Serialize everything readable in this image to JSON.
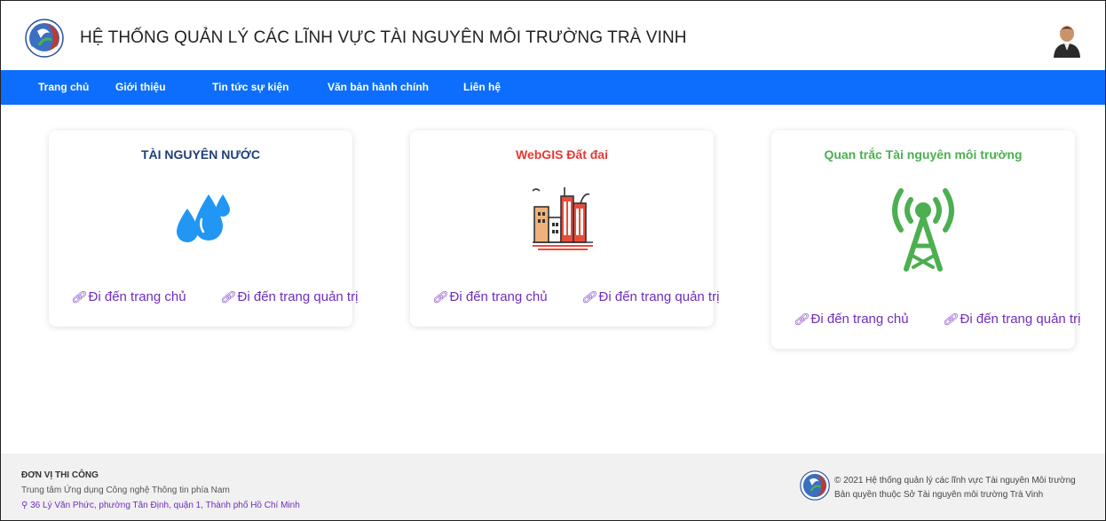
{
  "header": {
    "title": "HỆ THỐNG QUẢN LÝ CÁC LĨNH VỰC TÀI NGUYÊN MÔI TRƯỜNG TRÀ VINH"
  },
  "nav": {
    "items": [
      "Trang chủ",
      "Giới thiệu",
      "Tin tức sự kiện",
      "Văn bản hành chính",
      "Liên hệ"
    ]
  },
  "cards": [
    {
      "title": "TÀI NGUYÊN NƯỚC",
      "title_color": "#1f3f77",
      "icon": "water-drops-icon",
      "link_home": "Đi đến trang chủ",
      "link_admin": "Đi đến trang quản trị"
    },
    {
      "title": "WebGIS Đất đai",
      "title_color": "#e53935",
      "icon": "city-buildings-icon",
      "link_home": "Đi đến trang chủ",
      "link_admin": "Đi đến trang quản trị"
    },
    {
      "title": "Quan trắc Tài nguyên môi trường",
      "title_color": "#4caf50",
      "icon": "radio-tower-icon",
      "link_home": "Đi đến trang chủ",
      "link_admin": "Đi đến trang quản trị"
    }
  ],
  "footer": {
    "heading": "ĐƠN VỊ THI CÔNG",
    "org": "Trung tâm Ứng dụng Công nghệ Thông tin phía Nam",
    "address": "36 Lý Văn Phức, phường Tân Định, quận 1, Thành phố Hồ Chí Minh",
    "copyright": "© 2021 Hệ thống quản lý các lĩnh vực Tài nguyên Môi trường",
    "owner": "Bản quyền thuộc Sở Tài nguyên môi trường Trà Vinh"
  },
  "colors": {
    "nav_bg": "#0d6efd",
    "link": "#6f2dbd",
    "water": "#2196f3",
    "tower": "#4caf50"
  }
}
